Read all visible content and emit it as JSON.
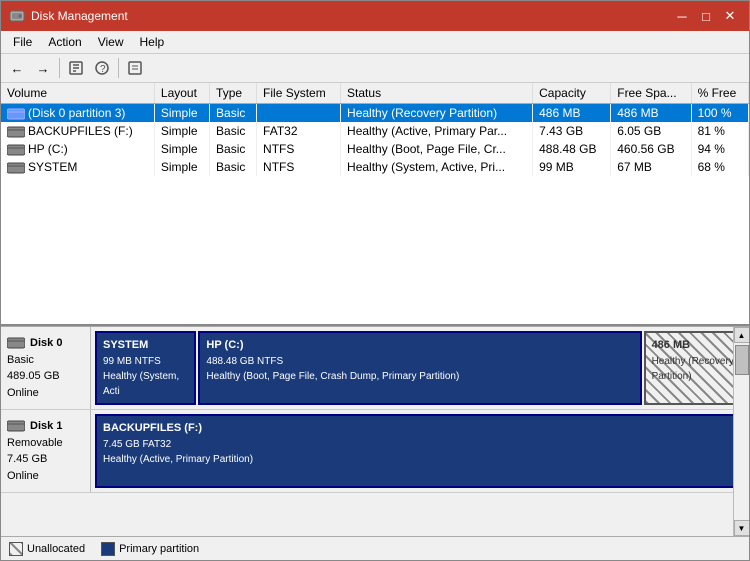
{
  "window": {
    "title": "Disk Management",
    "icon": "disk-icon"
  },
  "titlebar": {
    "minimize": "─",
    "maximize": "□",
    "close": "✕"
  },
  "menu": {
    "items": [
      "File",
      "Action",
      "View",
      "Help"
    ]
  },
  "toolbar": {
    "buttons": [
      "←",
      "→",
      "⊞",
      "?",
      "⊡",
      "⊟"
    ]
  },
  "table": {
    "headers": [
      "Volume",
      "Layout",
      "Type",
      "File System",
      "Status",
      "Capacity",
      "Free Spa...",
      "% Free"
    ],
    "rows": [
      {
        "volume": "(Disk 0 partition 3)",
        "layout": "Simple",
        "type": "Basic",
        "filesystem": "",
        "status": "Healthy (Recovery Partition)",
        "capacity": "486 MB",
        "free": "486 MB",
        "pct": "100 %",
        "selected": true
      },
      {
        "volume": "BACKUPFILES (F:)",
        "layout": "Simple",
        "type": "Basic",
        "filesystem": "FAT32",
        "status": "Healthy (Active, Primary Par...",
        "capacity": "7.43 GB",
        "free": "6.05 GB",
        "pct": "81 %",
        "selected": false
      },
      {
        "volume": "HP (C:)",
        "layout": "Simple",
        "type": "Basic",
        "filesystem": "NTFS",
        "status": "Healthy (Boot, Page File, Cr...",
        "capacity": "488.48 GB",
        "free": "460.56 GB",
        "pct": "94 %",
        "selected": false
      },
      {
        "volume": "SYSTEM",
        "layout": "Simple",
        "type": "Basic",
        "filesystem": "NTFS",
        "status": "Healthy (System, Active, Pri...",
        "capacity": "99 MB",
        "free": "67 MB",
        "pct": "68 %",
        "selected": false
      }
    ]
  },
  "disk_map": {
    "disks": [
      {
        "name": "Disk 0",
        "type": "Basic",
        "size": "489.05 GB",
        "status": "Online",
        "partitions": [
          {
            "label": "SYSTEM",
            "sublabel": "99 MB NTFS",
            "desc": "Healthy (System, Acti",
            "type": "ntfs",
            "flex": 2
          },
          {
            "label": "HP (C:)",
            "sublabel": "488.48 GB NTFS",
            "desc": "Healthy (Boot, Page File, Crash Dump, Primary Partition)",
            "type": "ntfs",
            "flex": 10
          },
          {
            "label": "486 MB",
            "sublabel": "Healthy (Recovery Partition)",
            "desc": "",
            "type": "unallocated",
            "flex": 2
          }
        ]
      },
      {
        "name": "Disk 1",
        "type": "Removable",
        "size": "7.45 GB",
        "status": "Online",
        "partitions": [
          {
            "label": "BACKUPFILES  (F:)",
            "sublabel": "7.45 GB FAT32",
            "desc": "Healthy (Active, Primary Partition)",
            "type": "fat32",
            "flex": 14
          }
        ]
      }
    ]
  },
  "legend": {
    "items": [
      {
        "type": "unallocated",
        "label": "Unallocated"
      },
      {
        "type": "primary",
        "label": "Primary partition"
      }
    ]
  }
}
